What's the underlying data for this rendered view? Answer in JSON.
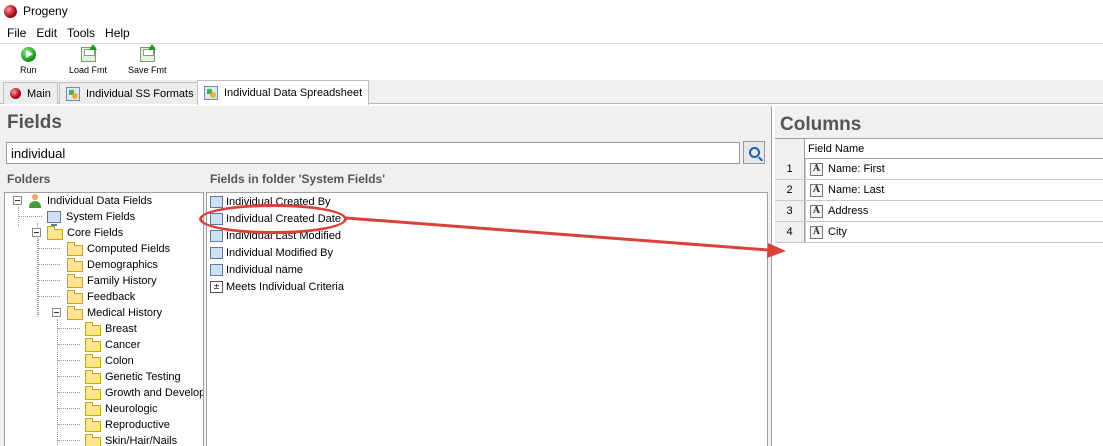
{
  "window": {
    "title": "Progeny"
  },
  "menu": [
    "File",
    "Edit",
    "Tools",
    "Help"
  ],
  "toolbar": {
    "run_label": "Run",
    "load_label": "Load Fmt",
    "save_label": "Save Fmt"
  },
  "tabs": [
    {
      "label": "Main",
      "icon": "progeny-ball-icon"
    },
    {
      "label": "Individual SS Formats",
      "icon": "spreadsheet-icon"
    },
    {
      "label": "Individual Data Spreadsheet",
      "icon": "spreadsheet-icon",
      "active": true
    }
  ],
  "fields_panel": {
    "title": "Fields",
    "search_value": "individual",
    "folders_label": "Folders",
    "fields_in_folder_label": "Fields in folder 'System Fields'"
  },
  "folder_tree": {
    "root": "Individual Data Fields",
    "system_fields": "System Fields",
    "core_fields": "Core Fields",
    "core_children": [
      "Computed Fields",
      "Demographics",
      "Family History",
      "Feedback"
    ],
    "medical_history": "Medical History",
    "medical_children": [
      "Breast",
      "Cancer",
      "Colon",
      "Genetic Testing",
      "Growth and Develop",
      "Neurologic",
      "Reproductive",
      "Skin/Hair/Nails"
    ]
  },
  "field_list": [
    {
      "label": "Individual Created By",
      "icon": "system-field-icon"
    },
    {
      "label": "Individual Created Date",
      "icon": "system-field-icon"
    },
    {
      "label": "Individual Last Modified",
      "icon": "system-field-icon"
    },
    {
      "label": "Individual Modified By",
      "icon": "system-field-icon"
    },
    {
      "label": "Individual name",
      "icon": "system-field-icon"
    },
    {
      "label": "Meets Individual Criteria",
      "icon": "criteria-icon"
    }
  ],
  "columns_panel": {
    "title": "Columns",
    "header": "Field Name",
    "rows": [
      {
        "num": "1",
        "name": "Name: First",
        "type_glyph": "A"
      },
      {
        "num": "2",
        "name": "Name: Last",
        "type_glyph": "A"
      },
      {
        "num": "3",
        "name": "Address",
        "type_glyph": "A"
      },
      {
        "num": "4",
        "name": "City",
        "type_glyph": "A"
      }
    ]
  },
  "annotation": {
    "color": "#d9423a"
  }
}
